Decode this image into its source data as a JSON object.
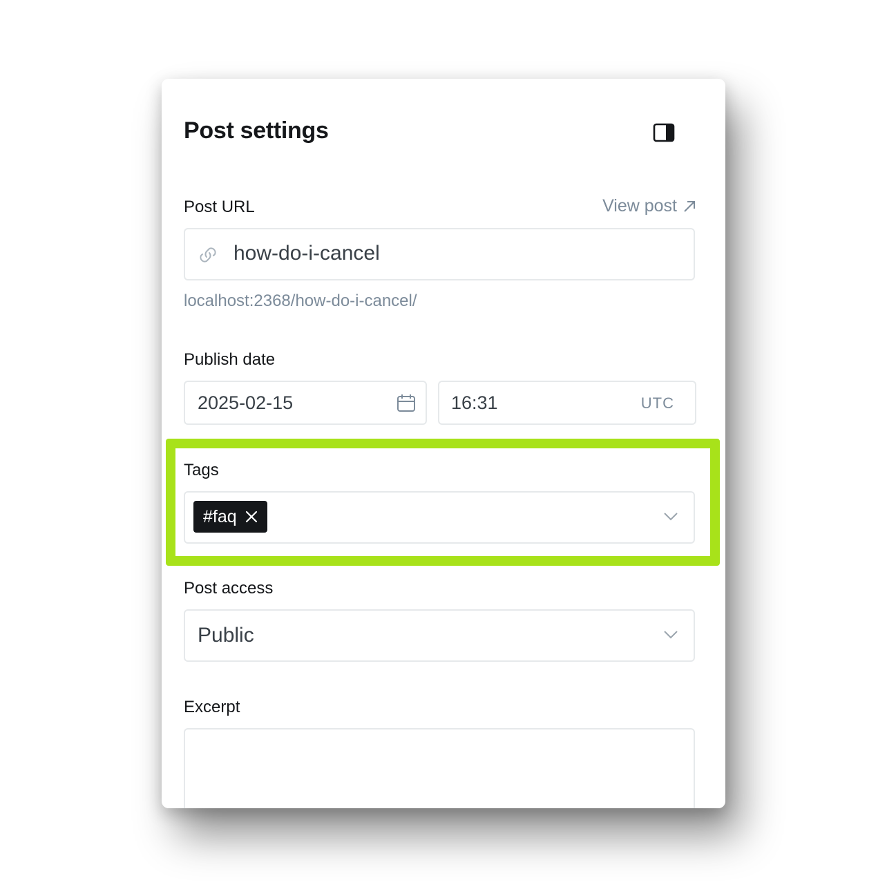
{
  "panel": {
    "title": "Post settings",
    "post_url": {
      "label": "Post URL",
      "view_post_label": "View post",
      "value": "how-do-i-cancel",
      "full_url": "localhost:2368/how-do-i-cancel/"
    },
    "publish_date": {
      "label": "Publish date",
      "date": "2025-02-15",
      "time": "16:31",
      "timezone": "UTC"
    },
    "tags": {
      "label": "Tags",
      "items": [
        {
          "name": "#faq"
        }
      ]
    },
    "post_access": {
      "label": "Post access",
      "selected": "Public"
    },
    "excerpt": {
      "label": "Excerpt",
      "value": ""
    }
  },
  "colors": {
    "highlight": "#a8e21a",
    "text_primary": "#15171a",
    "text_muted": "#7c8b9a",
    "border": "#e6e9eb",
    "chip_bg": "#15171a"
  }
}
